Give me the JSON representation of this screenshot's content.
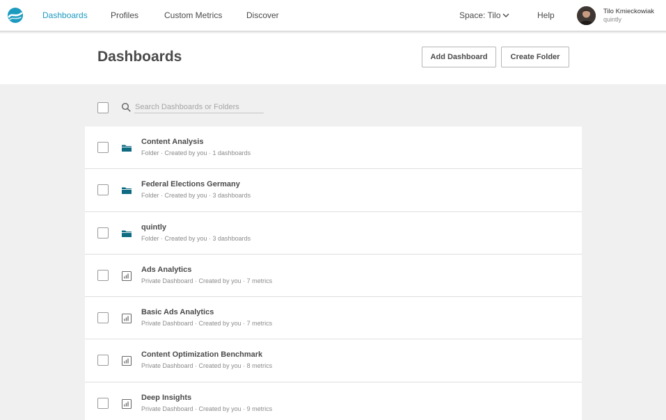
{
  "nav": {
    "items": [
      "Dashboards",
      "Profiles",
      "Custom Metrics",
      "Discover"
    ],
    "active_index": 0,
    "space_label": "Space: Tilo",
    "help_label": "Help",
    "user_name": "Tilo Kmieckowiak",
    "user_org": "quintly"
  },
  "header": {
    "title": "Dashboards",
    "add_dashboard_label": "Add Dashboard",
    "create_folder_label": "Create Folder"
  },
  "search": {
    "placeholder": "Search Dashboards or Folders",
    "value": ""
  },
  "items": [
    {
      "icon": "folder-icon",
      "title": "Content Analysis",
      "meta": "Folder · Created by you · 1 dashboards"
    },
    {
      "icon": "folder-icon",
      "title": "Federal Elections Germany",
      "meta": "Folder · Created by you · 3 dashboards"
    },
    {
      "icon": "folder-icon",
      "title": "quintly",
      "meta": "Folder · Created by you · 3 dashboards"
    },
    {
      "icon": "dashboard-chart-icon",
      "title": "Ads Analytics",
      "meta": "Private Dashboard · Created by you · 7 metrics"
    },
    {
      "icon": "dashboard-chart-icon",
      "title": "Basic Ads Analytics",
      "meta": "Private Dashboard · Created by you · 7 metrics"
    },
    {
      "icon": "dashboard-chart-icon",
      "title": "Content Optimization Benchmark",
      "meta": "Private Dashboard · Created by you · 8 metrics"
    },
    {
      "icon": "dashboard-chart-icon",
      "title": "Deep Insights",
      "meta": "Private Dashboard · Created by you · 9 metrics"
    }
  ],
  "colors": {
    "accent": "#1c9bc1",
    "folder": "#0f6b82",
    "text": "#4a4a4a",
    "muted": "#8a8a8a",
    "background": "#f0f0f0"
  }
}
